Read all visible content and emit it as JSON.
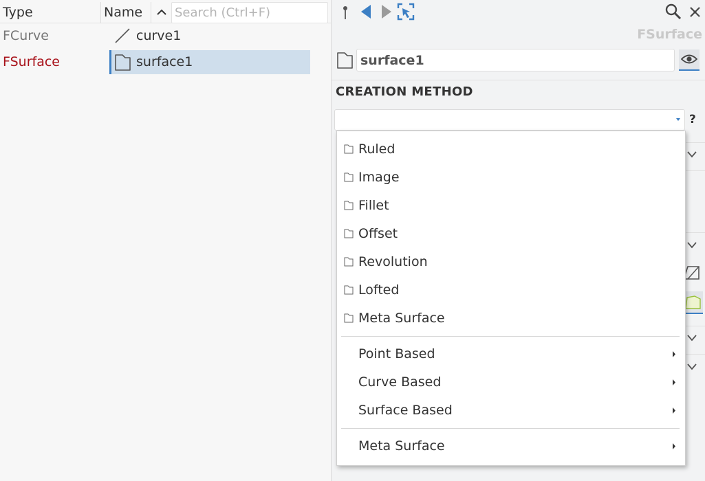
{
  "tree": {
    "header": {
      "type_label": "Type",
      "name_label": "Name",
      "search_placeholder": "Search (Ctrl+F)"
    },
    "rows": [
      {
        "type": "FCurve",
        "name": "curve1",
        "icon": "curve-icon",
        "selected": false
      },
      {
        "type": "FSurface",
        "name": "surface1",
        "icon": "surface-icon",
        "selected": true
      }
    ]
  },
  "properties": {
    "toolbar": {
      "icons": [
        "pin-icon",
        "back-arrow-icon",
        "forward-arrow-icon",
        "select-icon",
        "search-icon",
        "close-icon"
      ]
    },
    "object_type": "FSurface",
    "object_name": "surface1",
    "visibility_icon": "eye-icon",
    "section_title": "CREATION METHOD",
    "creation_method_value": "",
    "help_label": "?"
  },
  "dropdown": {
    "items": [
      {
        "label": "Ruled",
        "icon": "surface-icon"
      },
      {
        "label": "Image",
        "icon": "surface-icon"
      },
      {
        "label": "Fillet",
        "icon": "surface-icon"
      },
      {
        "label": "Offset",
        "icon": "surface-icon"
      },
      {
        "label": "Revolution",
        "icon": "surface-icon"
      },
      {
        "label": "Lofted",
        "icon": "surface-icon"
      },
      {
        "label": "Meta Surface",
        "icon": "surface-icon"
      }
    ],
    "submenus": [
      {
        "label": "Point Based"
      },
      {
        "label": "Curve Based"
      },
      {
        "label": "Surface Based"
      }
    ],
    "last_submenu": {
      "label": "Meta Surface"
    }
  },
  "colors": {
    "accent": "#3c7fc4",
    "selection": "#cfdeec",
    "surface_type": "#a8121a"
  }
}
